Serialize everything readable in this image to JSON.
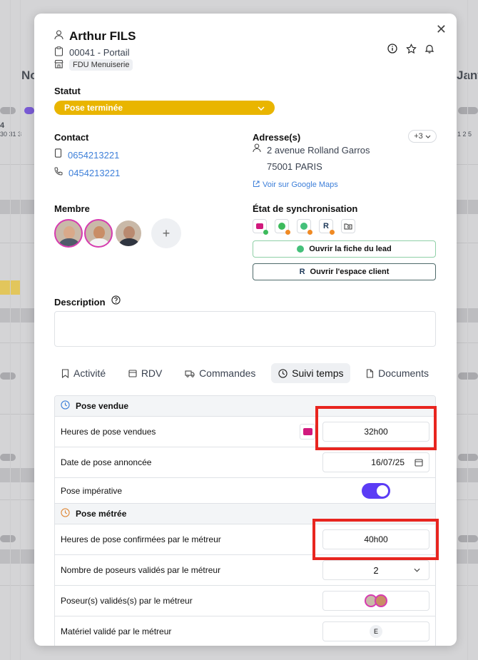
{
  "background": {
    "month_left": "No",
    "month_right": "Janv",
    "days_left": "30 31 3",
    "days_right": "1 2 5",
    "day_marker": "4"
  },
  "modal": {
    "close_icon": "close-icon",
    "name": "Arthur FILS",
    "project": "00041 - Portail",
    "company_tag": "FDU Menuiserie",
    "header_icons": [
      "info-icon",
      "star-icon",
      "bell-icon"
    ]
  },
  "status": {
    "label": "Statut",
    "value": "Pose terminée",
    "color": "#e9b500"
  },
  "contact": {
    "label": "Contact",
    "mobile": "0654213221",
    "phone": "0454213221"
  },
  "address": {
    "label": "Adresse(s)",
    "more": "+3",
    "street": "2 avenue Rolland Garros",
    "city": "75001 PARIS",
    "maps_link": "Voir sur Google Maps"
  },
  "members": {
    "label": "Membre",
    "add": "+"
  },
  "sync": {
    "label": "État de synchronisation",
    "open_lead": "Ouvrir la fiche du lead",
    "open_client": "Ouvrir l'espace client"
  },
  "description": {
    "label": "Description"
  },
  "tabs": [
    {
      "label": "Activité",
      "icon": "bookmark-icon"
    },
    {
      "label": "RDV",
      "icon": "calendar-icon"
    },
    {
      "label": "Commandes",
      "icon": "truck-icon"
    },
    {
      "label": "Suivi temps",
      "icon": "clock-icon"
    },
    {
      "label": "Documents",
      "icon": "document-icon"
    }
  ],
  "pose_vendue": {
    "title": "Pose vendue",
    "hours_label": "Heures de pose vendues",
    "hours_value": "32h00",
    "date_label": "Date de pose annoncée",
    "date_value": "16/07/25",
    "imperative_label": "Pose impérative",
    "imperative_on": true
  },
  "pose_metree": {
    "title": "Pose métrée",
    "confirmed_hours_label": "Heures de pose confirmées par le métreur",
    "confirmed_hours_value": "40h00",
    "poseurs_count_label": "Nombre de poseurs validés par le métreur",
    "poseurs_count_value": "2",
    "poseurs_label": "Poseur(s) validés(s) par le métreur",
    "materiel_label": "Matériel validé par le métreur",
    "materiel_value": "E"
  },
  "highlight_color": "#e8251f"
}
